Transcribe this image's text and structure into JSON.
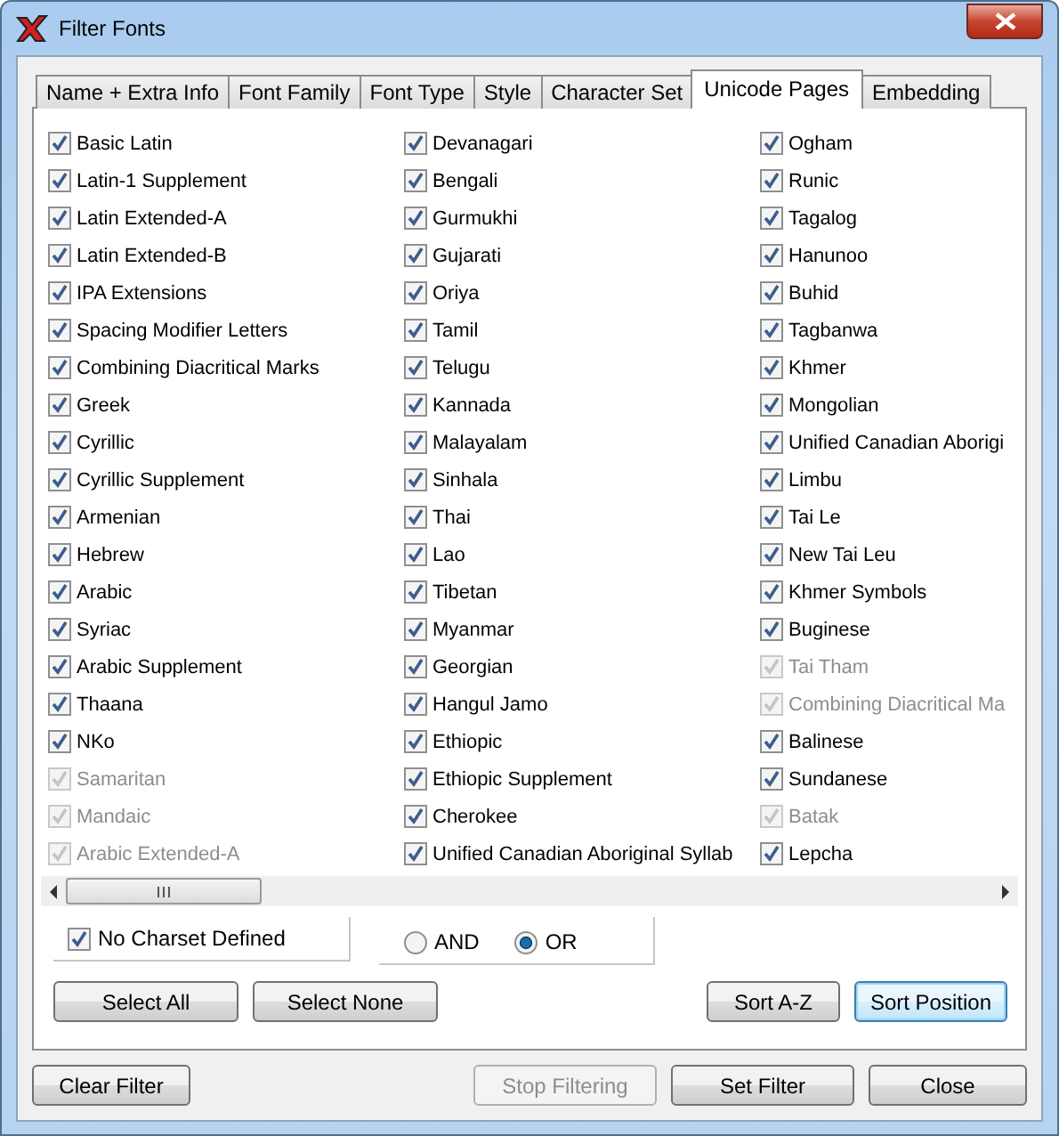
{
  "window": {
    "title": "Filter Fonts"
  },
  "tabs": [
    {
      "label": "Name + Extra Info",
      "selected": false
    },
    {
      "label": "Font Family",
      "selected": false
    },
    {
      "label": "Font Type",
      "selected": false
    },
    {
      "label": "Style",
      "selected": false
    },
    {
      "label": "Character Set",
      "selected": false
    },
    {
      "label": "Unicode Pages",
      "selected": true
    },
    {
      "label": "Embedding",
      "selected": false
    }
  ],
  "page_columns": [
    {
      "items": [
        {
          "label": "Basic Latin",
          "checked": true,
          "disabled": false
        },
        {
          "label": "Latin-1 Supplement",
          "checked": true,
          "disabled": false
        },
        {
          "label": "Latin Extended-A",
          "checked": true,
          "disabled": false
        },
        {
          "label": "Latin Extended-B",
          "checked": true,
          "disabled": false
        },
        {
          "label": "IPA Extensions",
          "checked": true,
          "disabled": false
        },
        {
          "label": "Spacing Modifier Letters",
          "checked": true,
          "disabled": false
        },
        {
          "label": "Combining Diacritical Marks",
          "checked": true,
          "disabled": false
        },
        {
          "label": "Greek",
          "checked": true,
          "disabled": false
        },
        {
          "label": "Cyrillic",
          "checked": true,
          "disabled": false
        },
        {
          "label": "Cyrillic Supplement",
          "checked": true,
          "disabled": false
        },
        {
          "label": "Armenian",
          "checked": true,
          "disabled": false
        },
        {
          "label": "Hebrew",
          "checked": true,
          "disabled": false
        },
        {
          "label": "Arabic",
          "checked": true,
          "disabled": false
        },
        {
          "label": "Syriac",
          "checked": true,
          "disabled": false
        },
        {
          "label": "Arabic Supplement",
          "checked": true,
          "disabled": false
        },
        {
          "label": "Thaana",
          "checked": true,
          "disabled": false
        },
        {
          "label": "NKo",
          "checked": true,
          "disabled": false
        },
        {
          "label": "Samaritan",
          "checked": true,
          "disabled": true
        },
        {
          "label": "Mandaic",
          "checked": true,
          "disabled": true
        },
        {
          "label": "Arabic Extended-A",
          "checked": true,
          "disabled": true
        }
      ]
    },
    {
      "items": [
        {
          "label": "Devanagari",
          "checked": true,
          "disabled": false
        },
        {
          "label": "Bengali",
          "checked": true,
          "disabled": false
        },
        {
          "label": "Gurmukhi",
          "checked": true,
          "disabled": false
        },
        {
          "label": "Gujarati",
          "checked": true,
          "disabled": false
        },
        {
          "label": "Oriya",
          "checked": true,
          "disabled": false
        },
        {
          "label": "Tamil",
          "checked": true,
          "disabled": false
        },
        {
          "label": "Telugu",
          "checked": true,
          "disabled": false
        },
        {
          "label": "Kannada",
          "checked": true,
          "disabled": false
        },
        {
          "label": "Malayalam",
          "checked": true,
          "disabled": false
        },
        {
          "label": "Sinhala",
          "checked": true,
          "disabled": false
        },
        {
          "label": "Thai",
          "checked": true,
          "disabled": false
        },
        {
          "label": "Lao",
          "checked": true,
          "disabled": false
        },
        {
          "label": "Tibetan",
          "checked": true,
          "disabled": false
        },
        {
          "label": "Myanmar",
          "checked": true,
          "disabled": false
        },
        {
          "label": "Georgian",
          "checked": true,
          "disabled": false
        },
        {
          "label": "Hangul Jamo",
          "checked": true,
          "disabled": false
        },
        {
          "label": "Ethiopic",
          "checked": true,
          "disabled": false
        },
        {
          "label": "Ethiopic Supplement",
          "checked": true,
          "disabled": false
        },
        {
          "label": "Cherokee",
          "checked": true,
          "disabled": false
        },
        {
          "label": "Unified Canadian Aboriginal Syllab",
          "checked": true,
          "disabled": false
        }
      ]
    },
    {
      "items": [
        {
          "label": "Ogham",
          "checked": true,
          "disabled": false
        },
        {
          "label": "Runic",
          "checked": true,
          "disabled": false
        },
        {
          "label": "Tagalog",
          "checked": true,
          "disabled": false
        },
        {
          "label": "Hanunoo",
          "checked": true,
          "disabled": false
        },
        {
          "label": "Buhid",
          "checked": true,
          "disabled": false
        },
        {
          "label": "Tagbanwa",
          "checked": true,
          "disabled": false
        },
        {
          "label": "Khmer",
          "checked": true,
          "disabled": false
        },
        {
          "label": "Mongolian",
          "checked": true,
          "disabled": false
        },
        {
          "label": "Unified Canadian Aborigi",
          "checked": true,
          "disabled": false
        },
        {
          "label": "Limbu",
          "checked": true,
          "disabled": false
        },
        {
          "label": "Tai Le",
          "checked": true,
          "disabled": false
        },
        {
          "label": "New Tai Leu",
          "checked": true,
          "disabled": false
        },
        {
          "label": "Khmer Symbols",
          "checked": true,
          "disabled": false
        },
        {
          "label": "Buginese",
          "checked": true,
          "disabled": false
        },
        {
          "label": "Tai Tham",
          "checked": true,
          "disabled": true
        },
        {
          "label": "Combining Diacritical Ma",
          "checked": true,
          "disabled": true
        },
        {
          "label": "Balinese",
          "checked": true,
          "disabled": false
        },
        {
          "label": "Sundanese",
          "checked": true,
          "disabled": false
        },
        {
          "label": "Batak",
          "checked": true,
          "disabled": true
        },
        {
          "label": "Lepcha",
          "checked": true,
          "disabled": false
        }
      ]
    }
  ],
  "no_charset": {
    "label": "No Charset Defined",
    "checked": true
  },
  "match_mode": [
    {
      "label": "AND",
      "selected": false
    },
    {
      "label": "OR",
      "selected": true
    }
  ],
  "panel_buttons": {
    "left": [
      {
        "label": "Select All",
        "focused": false
      },
      {
        "label": "Select None",
        "focused": false
      }
    ],
    "right": [
      {
        "label": "Sort A-Z",
        "focused": false
      },
      {
        "label": "Sort Position",
        "focused": true
      }
    ]
  },
  "footer_buttons": {
    "left": [
      {
        "label": "Clear Filter",
        "disabled": false
      }
    ],
    "right": [
      {
        "label": "Stop Filtering",
        "disabled": true
      },
      {
        "label": "Set Filter",
        "disabled": false
      },
      {
        "label": "Close",
        "disabled": false
      }
    ]
  }
}
